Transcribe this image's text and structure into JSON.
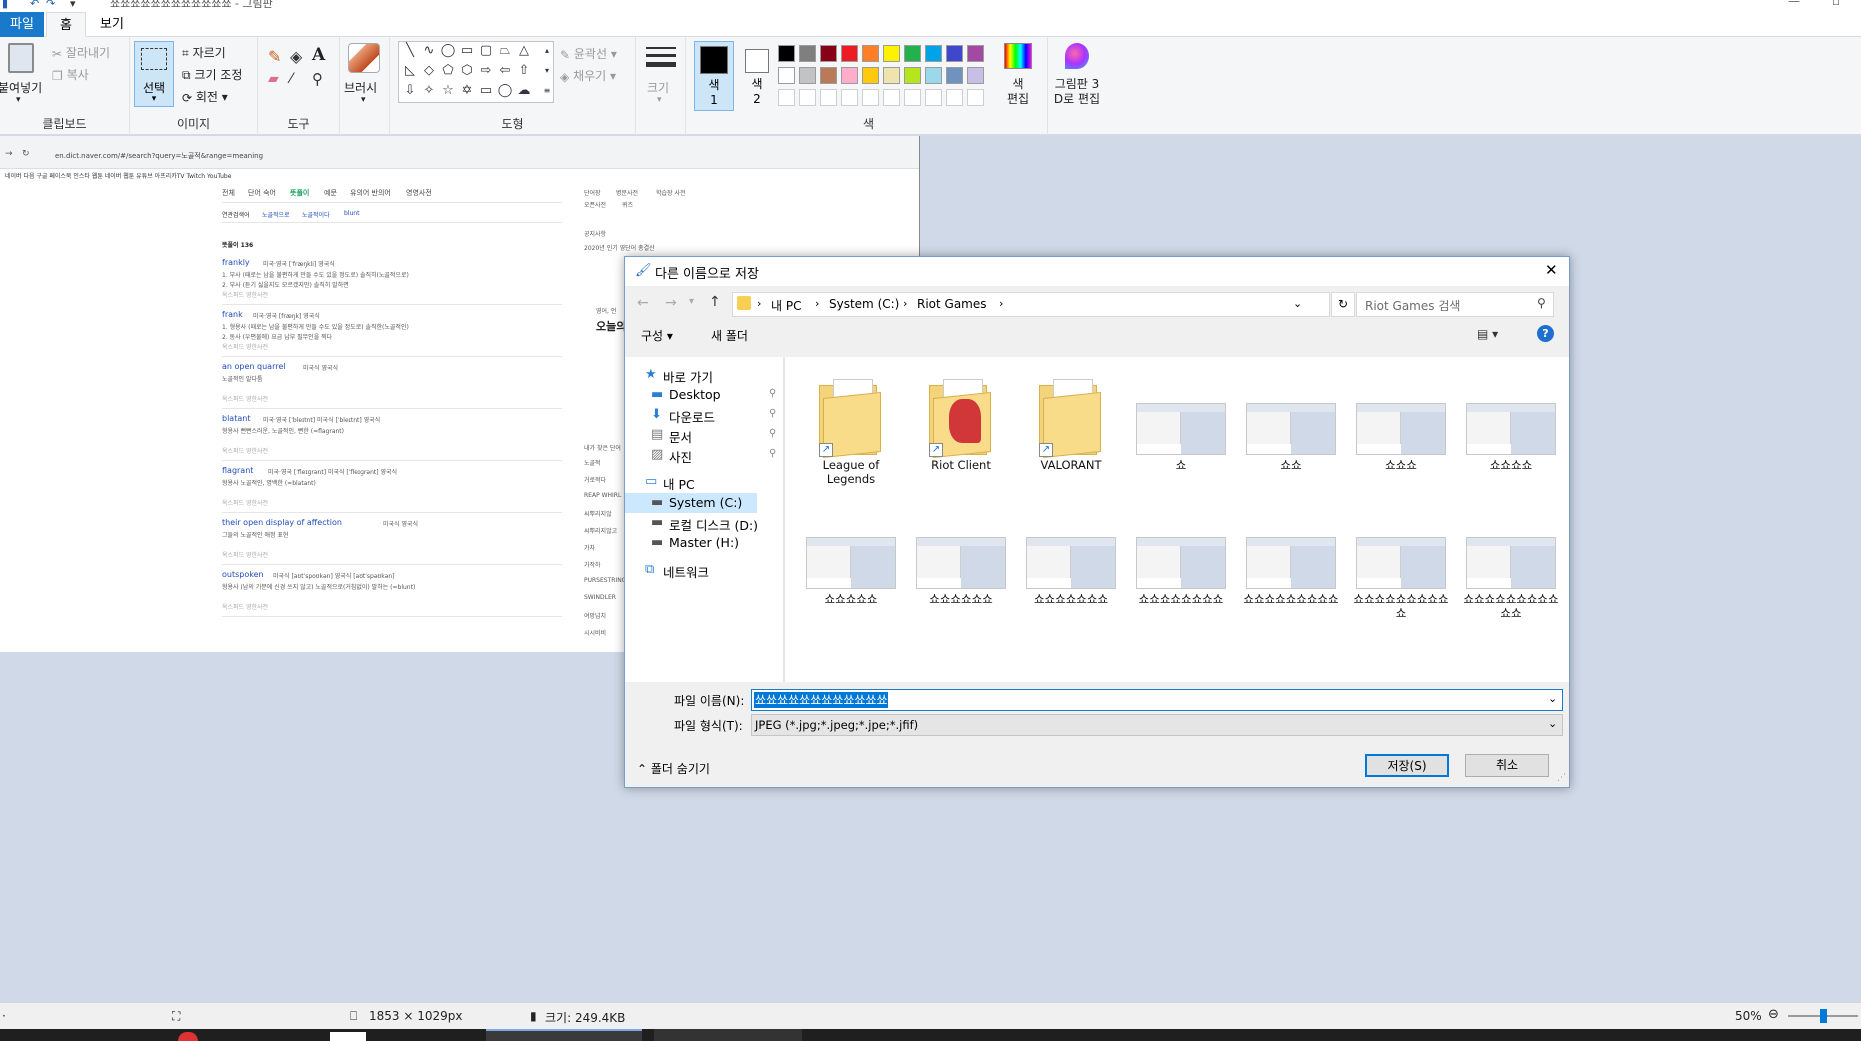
{
  "window": {
    "title": "쑈쑈쑈쑈쑈쑈쑈쑈쑈쑈쑈쑈 - 그림판"
  },
  "menu": {
    "tabs": [
      "파일",
      "홈",
      "보기"
    ]
  },
  "ribbon": {
    "clipboard": {
      "paste": "붙여넣기",
      "cut": "잘라내기",
      "copy": "복사",
      "group_label": "클립보드"
    },
    "image": {
      "select": "선택",
      "crop": "자르기",
      "resize": "크기 조정",
      "rotate": "회전",
      "group_label": "이미지"
    },
    "tools": {
      "group_label": "도구"
    },
    "brush": {
      "label": "브러시"
    },
    "shapes": {
      "outline": "윤곽선",
      "fill": "채우기",
      "group_label": "도형"
    },
    "size": {
      "label": "크기"
    },
    "color1": {
      "label": "색\n1"
    },
    "color2": {
      "label": "색\n2"
    },
    "colors": {
      "group_label": "색",
      "edit_label": "색\n편집",
      "palette_row1": [
        "#000000",
        "#7f7f7f",
        "#880015",
        "#ed1c24",
        "#ff7f27",
        "#fff200",
        "#22b14c",
        "#00a2e8",
        "#3f48cc",
        "#a349a4"
      ],
      "palette_row2": [
        "#ffffff",
        "#c3c3c3",
        "#b97a57",
        "#ffaec9",
        "#ffc90e",
        "#efe4b0",
        "#b5e61d",
        "#99d9ea",
        "#7092be",
        "#c8bfe7"
      ]
    },
    "paint3d": {
      "label": "그림판 3\nD로 편집"
    }
  },
  "pasted_image": {
    "url": "en.dict.naver.com/#/search?query=노골적&range=meaning",
    "bookmarks": "네이버  다음  구글  페이스북  인스타  웹툰  네이버 웹툰  유튜브  아프리카TV  Twitch  YouTube",
    "tabs": [
      "전체",
      "단어 숙어",
      "뜻풀이",
      "예문",
      "유의어 반의어",
      "영영사전"
    ],
    "related": [
      "연관검색어",
      "노골적으로",
      "노골적이다",
      "blunt"
    ],
    "section": "뜻풀이 136",
    "entries": [
      {
        "word": "frankly",
        "meta": "미국·영국 [ˈfræŋkli] 영국식",
        "def1": "1. 부사 (때로는 남을 불편하게 만들 수도 있을 정도로) 솔직히(노골적으로)",
        "def2": "2. 부사 (듣기 싫을지도 모르겠지만) 솔직히 말하면",
        "src": "옥스퍼드 영한사전"
      },
      {
        "word": "frank",
        "meta": "미국·영국 [fræŋk] 영국식",
        "def1": "1. 형용사 (때로는 남을 불편하게 만들 수도 있을 정도로) 솔직한(노골적인)",
        "def2": "2. 동사 (우편물에) 요금 납부 필무인을 찍다",
        "src": "옥스퍼드 영한사전"
      },
      {
        "word": "an open quarrel",
        "meta": "미국식 영국식",
        "def1": "노골적인 말다툼",
        "def2": "",
        "src": "옥스퍼드 영한사전"
      },
      {
        "word": "blatant",
        "meta": "미국·영국 [ˈbleɪtnt] 미국식 [ˈbleɪtnt] 영국식",
        "def1": "형용사 뻔뻔스러운, 노골적인, 뻔한 (=flagrant)",
        "def2": "",
        "src": "옥스퍼드 영한사전"
      },
      {
        "word": "flagrant",
        "meta": "미국·영국 [ˈfleɪɡrənt] 미국식 [ˈfleɪɡrənt] 영국식",
        "def1": "형용사 노골적인, 명백한 (=blatant)",
        "def2": "",
        "src": "옥스퍼드 영한사전"
      },
      {
        "word": "their open display of affection",
        "meta": "미국식 영국식",
        "def1": "그들의 노골적인 애정 표현",
        "def2": "",
        "src": "옥스퍼드 영한사전"
      },
      {
        "word": "outspoken",
        "meta": "미국식 [aʊtˈspoʊkən] 영국식 [aʊtˈspəʊkən]",
        "def1": "형용사 (남의 기분에 신경 쓰지 않고) 노골적으로(거침없이) 말하는 (=blunt)",
        "def2": "",
        "src": "옥스퍼드 영한사전"
      }
    ],
    "side": [
      "단어장",
      "병문사전",
      "학습장 사전",
      "오픈사전",
      "퀴즈",
      "공지사항",
      "2020년 인기 영단어 총결산",
      "영어, 언",
      "오늘의",
      "내가 찾은 단어",
      "노골적",
      "거로적다",
      "REAP WHIRL",
      "씨뿌리지않",
      "씨뿌리지않고",
      "가차",
      "가작하",
      "PURSESTRING",
      "SWINDLER",
      "여망넘치",
      "시시비비"
    ]
  },
  "dialog": {
    "title": "다른 이름으로 저장",
    "breadcrumb": [
      "내 PC",
      "System (C:)",
      "Riot Games"
    ],
    "search_placeholder": "Riot Games 검색",
    "organize": "구성",
    "new_folder": "새 폴더",
    "nav": [
      {
        "label": "바로 가기",
        "icon": "star-icon"
      },
      {
        "label": "Desktop",
        "icon": "desktop-icon",
        "pinned": true
      },
      {
        "label": "다운로드",
        "icon": "download-icon",
        "pinned": true
      },
      {
        "label": "문서",
        "icon": "document-icon",
        "pinned": true
      },
      {
        "label": "사진",
        "icon": "pictures-icon",
        "pinned": true
      },
      {
        "label": "내 PC",
        "icon": "pc-icon"
      },
      {
        "label": "System (C:)",
        "icon": "drive-icon",
        "selected": true
      },
      {
        "label": "로컬 디스크 (D:)",
        "icon": "drive-icon"
      },
      {
        "label": "Master (H:)",
        "icon": "drive-icon"
      },
      {
        "label": "네트워크",
        "icon": "network-icon"
      }
    ],
    "items": [
      {
        "label": "League of Legends",
        "type": "folder"
      },
      {
        "label": "Riot Client",
        "type": "folder-riot"
      },
      {
        "label": "VALORANT",
        "type": "folder"
      },
      {
        "label": "쇼",
        "type": "image"
      },
      {
        "label": "쇼쇼",
        "type": "image"
      },
      {
        "label": "쇼쇼쇼",
        "type": "image"
      },
      {
        "label": "쇼쇼쇼쇼",
        "type": "image"
      },
      {
        "label": "쇼쇼쇼쇼쇼",
        "type": "image"
      },
      {
        "label": "쇼쇼쇼쇼쇼쇼",
        "type": "image"
      },
      {
        "label": "쇼쇼쇼쇼쇼쇼쇼",
        "type": "image"
      },
      {
        "label": "쇼쇼쇼쇼쇼쇼쇼쇼",
        "type": "image"
      },
      {
        "label": "쇼쇼쇼쇼쇼쇼쇼쇼쇼",
        "type": "image"
      },
      {
        "label": "쇼쇼쇼쇼쇼쇼쇼쇼쇼쇼",
        "type": "image"
      },
      {
        "label": "쇼쇼쇼쇼쇼쇼쇼쇼쇼쇼쇼",
        "type": "image"
      }
    ],
    "filename_label": "파일 이름(N):",
    "filename_value": "쑈쑈쑈쑈쑈쑈쑈쑈쑈쑈쑈쑈",
    "filetype_label": "파일 형식(T):",
    "filetype_value": "JPEG (*.jpg;*.jpeg;*.jpe;*.jfif)",
    "hide_folders": "폴더 숨기기",
    "save": "저장(S)",
    "cancel": "취소"
  },
  "statusbar": {
    "dimensions": "1853 × 1029px",
    "size": "크기: 249.4KB",
    "zoom": "50%",
    "zoom_level": 0.5
  },
  "colors": {
    "accent": "#1979ca",
    "canvas_bg": "#cfd9e8"
  }
}
